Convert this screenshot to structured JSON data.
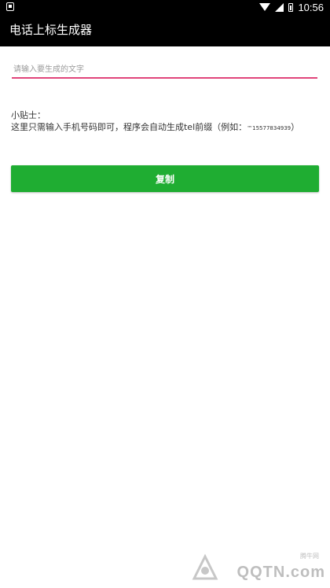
{
  "status_bar": {
    "time": "10:56",
    "icons": [
      "notification-icon",
      "wifi-icon",
      "signal-icon",
      "battery-icon"
    ]
  },
  "app_bar": {
    "title": "电话上标生成器"
  },
  "input": {
    "placeholder": "请输入要生成的文字",
    "value": ""
  },
  "tips": {
    "title": "小贴士：",
    "body": "这里只需输入手机号码即可，程序会自动生成tel前缀（例如：",
    "example": "™15577834939",
    "closing": "）"
  },
  "copy_button": {
    "label": "复制"
  },
  "watermark": {
    "name": "腾牛网",
    "brand": "QQTN.com"
  },
  "colors": {
    "accent": "#e0457b",
    "button": "#1fad32",
    "bar": "#000000"
  }
}
